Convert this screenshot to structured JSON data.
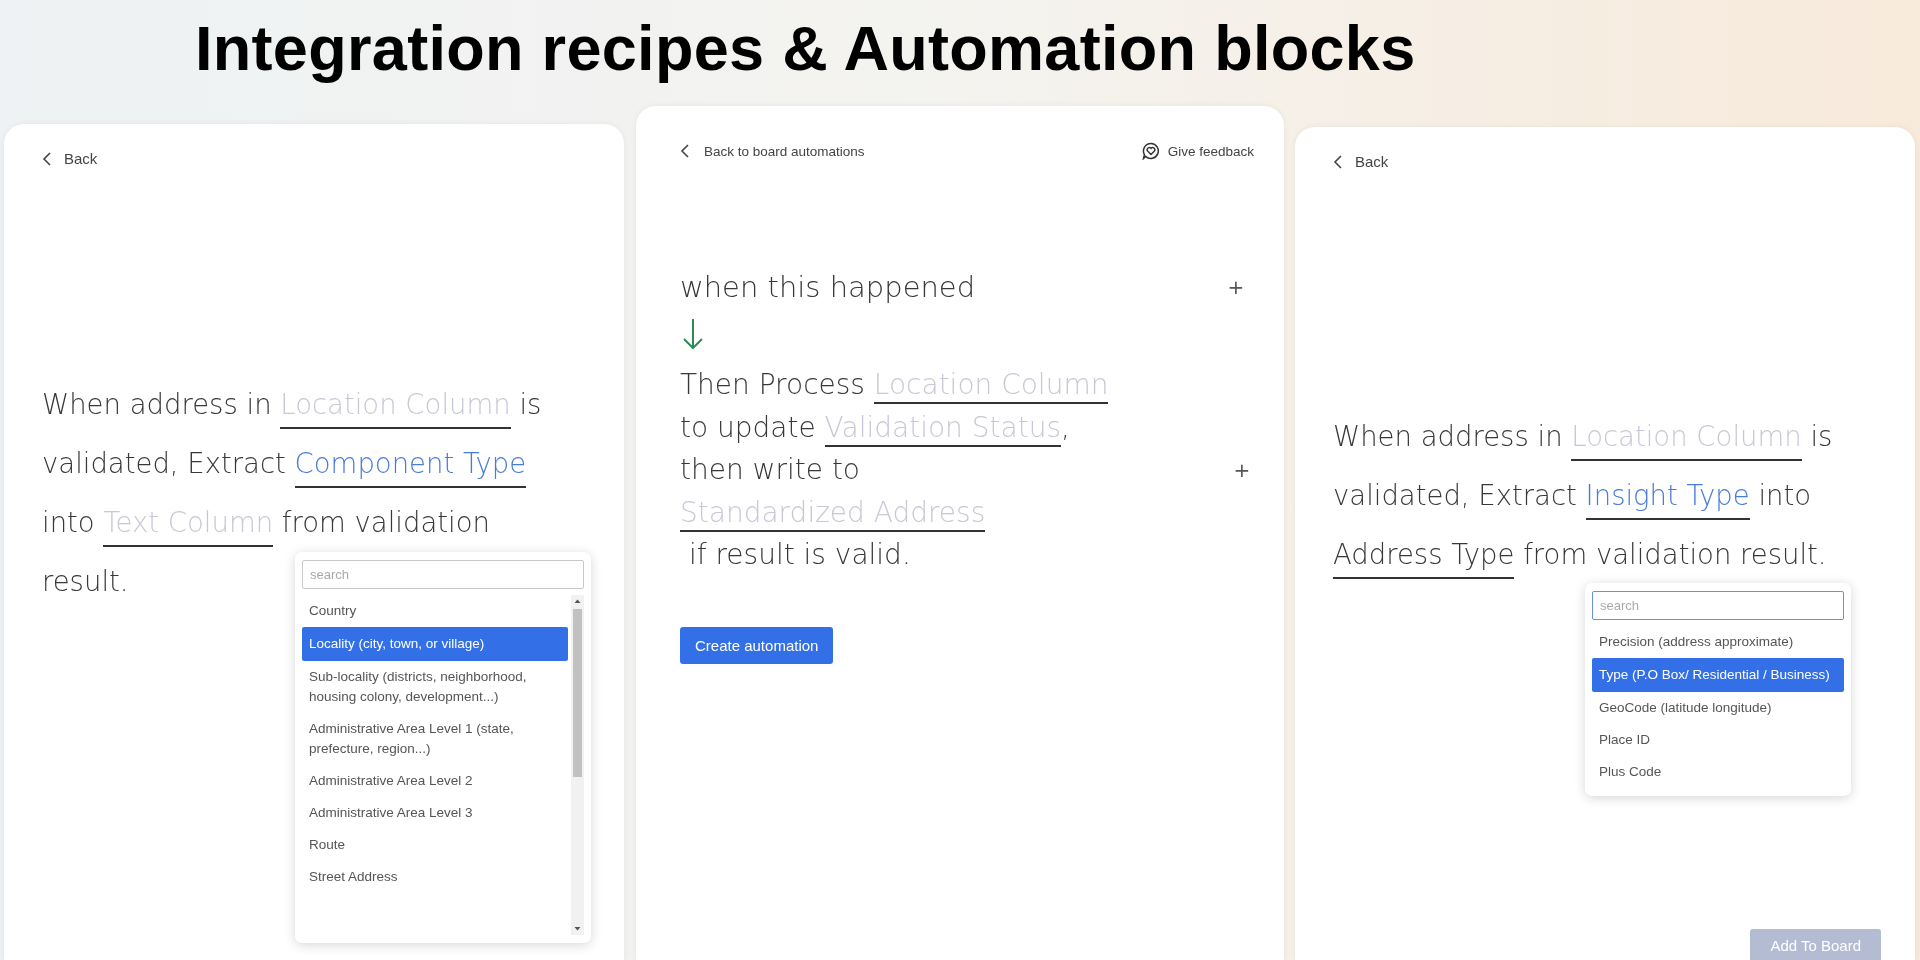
{
  "title": "Integration recipes & Automation blocks",
  "panels": [
    {
      "kind": "recipe",
      "back": "Back",
      "lines": [
        [
          {
            "kind": "text",
            "text": "When address in "
          },
          {
            "kind": "field",
            "empty": true,
            "selected": false,
            "text": "Location Column"
          },
          {
            "kind": "text",
            "text": " is"
          }
        ],
        [
          {
            "kind": "text",
            "text": "validated, Extract "
          },
          {
            "kind": "field",
            "empty": false,
            "selected": true,
            "text": "Component Type"
          }
        ],
        [
          {
            "kind": "text",
            "text": "into "
          },
          {
            "kind": "field",
            "empty": true,
            "selected": false,
            "text": "Text Column"
          },
          {
            "kind": "text",
            "text": " from validation"
          }
        ],
        [
          {
            "kind": "text",
            "text": "result."
          }
        ]
      ],
      "menu": {
        "placeholder": "search",
        "focused": false,
        "scrollbar": true,
        "items": [
          {
            "label": "Country",
            "selected": false
          },
          {
            "label": "Locality (city, town, or village)",
            "selected": true
          },
          {
            "label": "Sub-locality (districts, neighborhood, housing colony, development...)",
            "selected": false
          },
          {
            "label": "Administrative Area Level 1 (state, prefecture, region...)",
            "selected": false
          },
          {
            "label": "Administrative Area Level 2",
            "selected": false
          },
          {
            "label": "Administrative Area Level 3",
            "selected": false
          },
          {
            "label": "Route",
            "selected": false
          },
          {
            "label": "Street Address",
            "selected": false
          }
        ]
      }
    },
    {
      "kind": "automation",
      "back": "Back to board automations",
      "feedback": "Give feedback",
      "trigger": {
        "text": "when this happened",
        "add": "+"
      },
      "action": {
        "add": "+",
        "lines": [
          [
            {
              "kind": "text",
              "text": "Then Process "
            },
            {
              "kind": "field",
              "empty": true,
              "selected": false,
              "text": "Location Column"
            }
          ],
          [
            {
              "kind": "text",
              "text": "to update "
            },
            {
              "kind": "field",
              "empty": true,
              "selected": false,
              "text": "Validation Status"
            },
            {
              "kind": "text",
              "text": ","
            }
          ],
          [
            {
              "kind": "text",
              "text": "then write to"
            }
          ],
          [
            {
              "kind": "field",
              "empty": true,
              "selected": false,
              "text": "Standardized Address"
            }
          ],
          [
            {
              "kind": "text",
              "text": " if result is valid."
            }
          ]
        ]
      },
      "button": "Create automation"
    },
    {
      "kind": "recipe",
      "back": "Back",
      "lines": [
        [
          {
            "kind": "text",
            "text": "When address in "
          },
          {
            "kind": "field",
            "empty": true,
            "selected": false,
            "text": "Location Column"
          },
          {
            "kind": "text",
            "text": " is"
          }
        ],
        [
          {
            "kind": "text",
            "text": "validated, Extract "
          },
          {
            "kind": "field",
            "empty": false,
            "selected": true,
            "text": "Insight Type"
          },
          {
            "kind": "text",
            "text": " into"
          }
        ],
        [
          {
            "kind": "field",
            "empty": false,
            "selected": false,
            "text": "Address Type"
          },
          {
            "kind": "text",
            "text": " from validation result."
          }
        ]
      ],
      "menu": {
        "placeholder": "search",
        "focused": true,
        "scrollbar": false,
        "items": [
          {
            "label": "Precision (address approximate)",
            "selected": false
          },
          {
            "label": "Type (P.O Box/ Residential / Business)",
            "selected": true
          },
          {
            "label": "GeoCode (latitude longitude)",
            "selected": false
          },
          {
            "label": "Place ID",
            "selected": false
          },
          {
            "label": "Plus Code",
            "selected": false
          }
        ]
      },
      "add_button": "Add To Board"
    }
  ]
}
